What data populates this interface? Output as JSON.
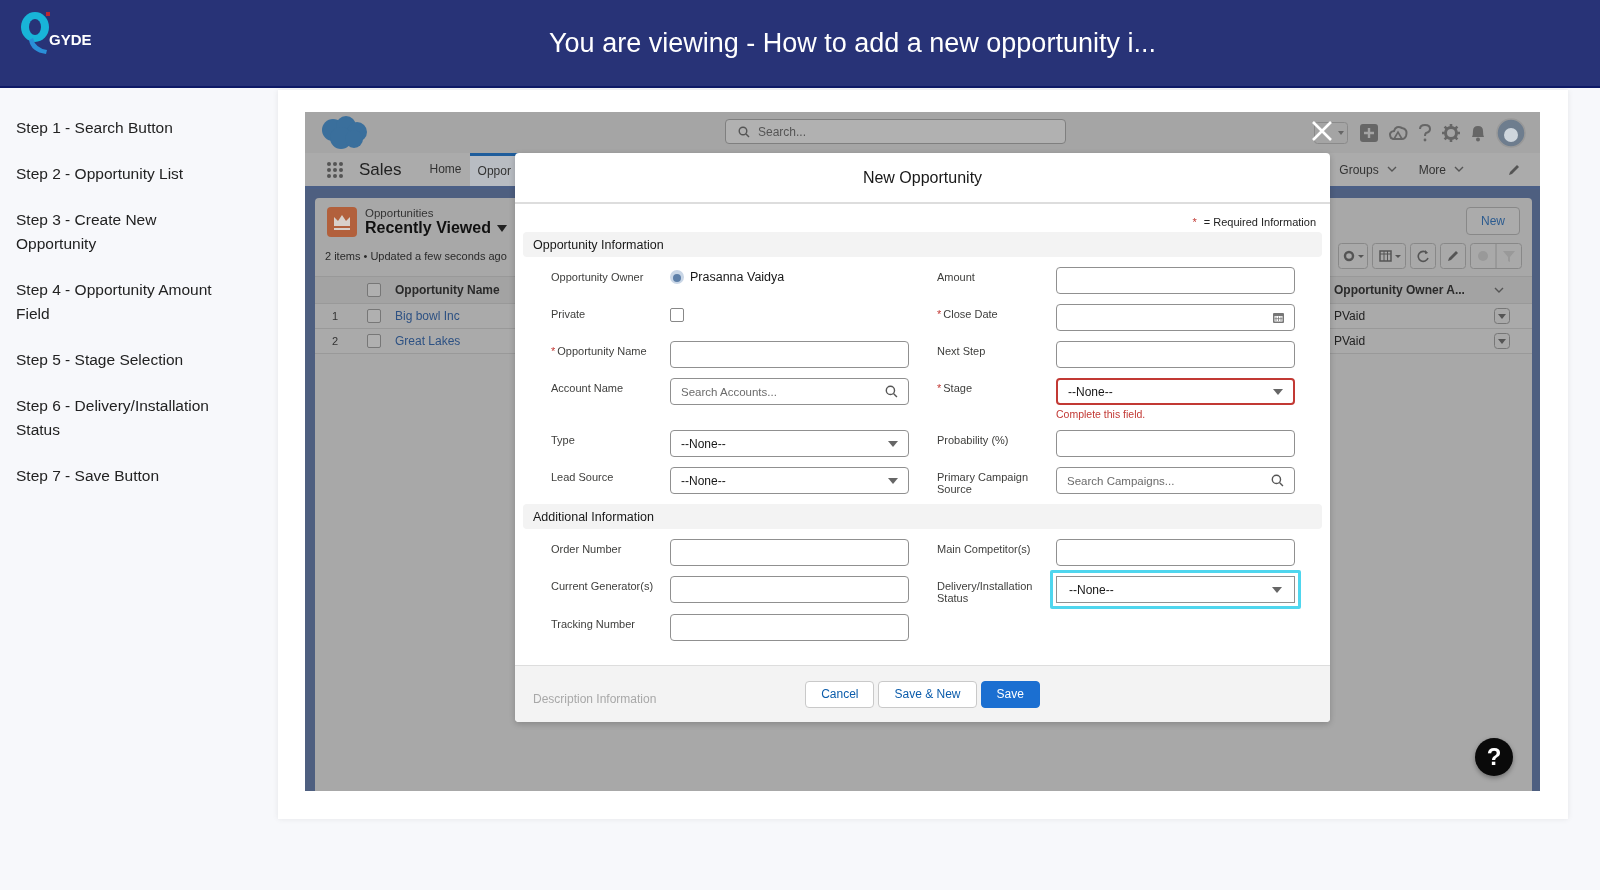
{
  "header": {
    "logo_text": "GYDE",
    "title": "You are viewing - How to add a new opportunity i..."
  },
  "steps": [
    "Step 1 - Search Button",
    "Step 2 - Opportunity List",
    "Step 3 - Create New Opportunity",
    "Step 4 - Opportunity Amount Field",
    "Step 5 - Stage Selection",
    "Step 6 - Delivery/Installation Status",
    "Step 7 - Save Button"
  ],
  "app": {
    "search_placeholder": "Search...",
    "app_name": "Sales",
    "nav_tabs": [
      {
        "label": "Home",
        "selected": false
      },
      {
        "label": "Oppor",
        "selected": true
      }
    ],
    "nav_menus": [
      "Groups",
      "More"
    ],
    "list": {
      "select_all_checked": false,
      "object_label": "Opportunities",
      "view_name": "Recently Viewed",
      "meta": "2 items • Updated a few seconds ago",
      "new_button": "New",
      "columns": [
        "Opportunity Name",
        "Opportunity Owner A..."
      ],
      "rows": [
        {
          "number": "1",
          "name": "Big bowl Inc",
          "owner": "PVaid",
          "checked": false
        },
        {
          "number": "2",
          "name": "Great Lakes",
          "owner": "PVaid",
          "checked": false
        }
      ]
    }
  },
  "modal": {
    "title": "New Opportunity",
    "required_mark": "*",
    "required_note": "= Required Information",
    "sections": [
      {
        "title": "Opportunity Information",
        "fields": [
          {
            "label": "Opportunity Owner",
            "required": false,
            "kind": "owner",
            "value": "Prasanna Vaidya",
            "highlighted": false
          },
          {
            "label": "Amount",
            "required": false,
            "kind": "text",
            "highlighted": false
          },
          {
            "label": "Private",
            "required": false,
            "kind": "checkbox",
            "checked": false,
            "highlighted": false
          },
          {
            "label": "Close Date",
            "required": true,
            "kind": "date",
            "highlighted": false
          },
          {
            "label": "Opportunity Name",
            "required": true,
            "kind": "text",
            "highlighted": false
          },
          {
            "label": "Next Step",
            "required": false,
            "kind": "text",
            "highlighted": false
          },
          {
            "label": "Account Name",
            "required": false,
            "kind": "lookup",
            "placeholder": "Search Accounts...",
            "highlighted": false
          },
          {
            "label": "Stage",
            "required": true,
            "kind": "select",
            "value": "--None--",
            "error": "Complete this field.",
            "highlighted": false
          },
          {
            "label": "Type",
            "required": false,
            "kind": "select",
            "value": "--None--",
            "highlighted": false
          },
          {
            "label": "Probability (%)",
            "required": false,
            "kind": "text",
            "highlighted": false
          },
          {
            "label": "Lead Source",
            "required": false,
            "kind": "select",
            "value": "--None--",
            "highlighted": false
          },
          {
            "label": "Primary Campaign Source",
            "required": false,
            "kind": "lookup",
            "placeholder": "Search Campaigns...",
            "highlighted": false
          }
        ]
      },
      {
        "title": "Additional Information",
        "fields": [
          {
            "label": "Order Number",
            "required": false,
            "kind": "text",
            "highlighted": false
          },
          {
            "label": "Main Competitor(s)",
            "required": false,
            "kind": "text",
            "highlighted": false
          },
          {
            "label": "Current Generator(s)",
            "required": false,
            "kind": "text",
            "highlighted": false
          },
          {
            "label": "Delivery/Installation Status",
            "required": false,
            "kind": "select",
            "value": "--None--",
            "highlighted": true
          },
          {
            "label": "Tracking Number",
            "required": false,
            "kind": "text",
            "highlighted": false
          }
        ]
      }
    ],
    "faded_section": "Description Information",
    "buttons": [
      {
        "label": "Cancel",
        "kind": "neutral"
      },
      {
        "label": "Save & New",
        "kind": "neutral"
      },
      {
        "label": "Save",
        "kind": "brand"
      }
    ]
  },
  "help_button": "?"
}
